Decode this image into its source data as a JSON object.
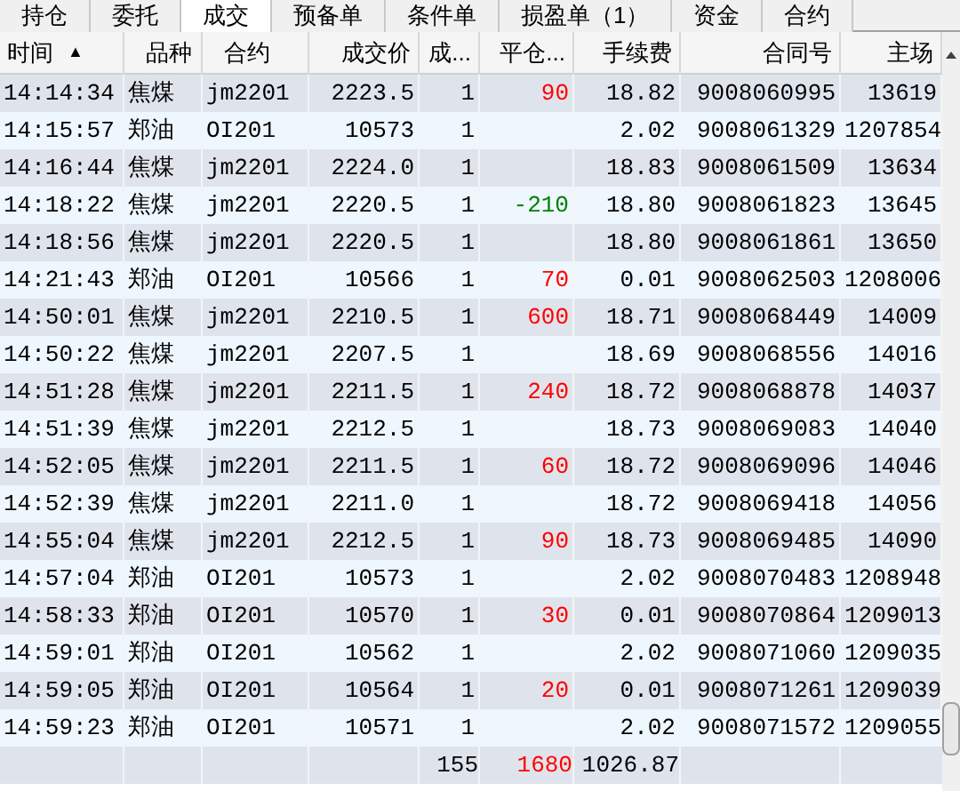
{
  "tabs": [
    {
      "label": "持仓",
      "selected": false
    },
    {
      "label": "委托",
      "selected": false
    },
    {
      "label": "成交",
      "selected": true
    },
    {
      "label": "预备单",
      "selected": false
    },
    {
      "label": "条件单",
      "selected": false
    },
    {
      "label": "损盈单（1）",
      "selected": false
    },
    {
      "label": "资金",
      "selected": false
    },
    {
      "label": "合约",
      "selected": false
    }
  ],
  "table": {
    "columns": [
      "时间",
      "品种",
      "合约",
      "成交价",
      "成...",
      "平仓...",
      "手续费",
      "合同号",
      "主场"
    ],
    "sort_indicator": "▲",
    "rows": [
      {
        "cells": [
          "14:14:34",
          "焦煤",
          "jm2201",
          "2223.5",
          "1",
          {
            "text": "90",
            "color": "#ff0000"
          },
          "18.82",
          "9008060995",
          "13619"
        ]
      },
      {
        "cells": [
          "14:15:57",
          "郑油",
          "OI201",
          "10573",
          "1",
          null,
          "2.02",
          "9008061329",
          "1207854"
        ]
      },
      {
        "cells": [
          "14:16:44",
          "焦煤",
          "jm2201",
          "2224.0",
          "1",
          null,
          "18.83",
          "9008061509",
          "13634"
        ]
      },
      {
        "cells": [
          "14:18:22",
          "焦煤",
          "jm2201",
          "2220.5",
          "1",
          {
            "text": "-210",
            "color": "#008000"
          },
          "18.80",
          "9008061823",
          "13645"
        ]
      },
      {
        "cells": [
          "14:18:56",
          "焦煤",
          "jm2201",
          "2220.5",
          "1",
          null,
          "18.80",
          "9008061861",
          "13650"
        ]
      },
      {
        "cells": [
          "14:21:43",
          "郑油",
          "OI201",
          "10566",
          "1",
          {
            "text": "70",
            "color": "#ff0000"
          },
          "0.01",
          "9008062503",
          "1208006"
        ]
      },
      {
        "cells": [
          "14:50:01",
          "焦煤",
          "jm2201",
          "2210.5",
          "1",
          {
            "text": "600",
            "color": "#ff0000"
          },
          "18.71",
          "9008068449",
          "14009"
        ]
      },
      {
        "cells": [
          "14:50:22",
          "焦煤",
          "jm2201",
          "2207.5",
          "1",
          null,
          "18.69",
          "9008068556",
          "14016"
        ]
      },
      {
        "cells": [
          "14:51:28",
          "焦煤",
          "jm2201",
          "2211.5",
          "1",
          {
            "text": "240",
            "color": "#ff0000"
          },
          "18.72",
          "9008068878",
          "14037"
        ]
      },
      {
        "cells": [
          "14:51:39",
          "焦煤",
          "jm2201",
          "2212.5",
          "1",
          null,
          "18.73",
          "9008069083",
          "14040"
        ]
      },
      {
        "cells": [
          "14:52:05",
          "焦煤",
          "jm2201",
          "2211.5",
          "1",
          {
            "text": "60",
            "color": "#ff0000"
          },
          "18.72",
          "9008069096",
          "14046"
        ]
      },
      {
        "cells": [
          "14:52:39",
          "焦煤",
          "jm2201",
          "2211.0",
          "1",
          null,
          "18.72",
          "9008069418",
          "14056"
        ]
      },
      {
        "cells": [
          "14:55:04",
          "焦煤",
          "jm2201",
          "2212.5",
          "1",
          {
            "text": "90",
            "color": "#ff0000"
          },
          "18.73",
          "9008069485",
          "14090"
        ]
      },
      {
        "cells": [
          "14:57:04",
          "郑油",
          "OI201",
          "10573",
          "1",
          null,
          "2.02",
          "9008070483",
          "1208948"
        ]
      },
      {
        "cells": [
          "14:58:33",
          "郑油",
          "OI201",
          "10570",
          "1",
          {
            "text": "30",
            "color": "#ff0000"
          },
          "0.01",
          "9008070864",
          "1209013"
        ]
      },
      {
        "cells": [
          "14:59:01",
          "郑油",
          "OI201",
          "10562",
          "1",
          null,
          "2.02",
          "9008071060",
          "1209035"
        ]
      },
      {
        "cells": [
          "14:59:05",
          "郑油",
          "OI201",
          "10564",
          "1",
          {
            "text": "20",
            "color": "#ff0000"
          },
          "0.01",
          "9008071261",
          "1209039"
        ]
      },
      {
        "cells": [
          "14:59:23",
          "郑油",
          "OI201",
          "10571",
          "1",
          null,
          "2.02",
          "9008071572",
          "1209055"
        ]
      }
    ],
    "totals": {
      "quantity": "155",
      "pnl": {
        "text": "1680",
        "color": "#ff0000"
      },
      "fee": "1026.87"
    }
  }
}
